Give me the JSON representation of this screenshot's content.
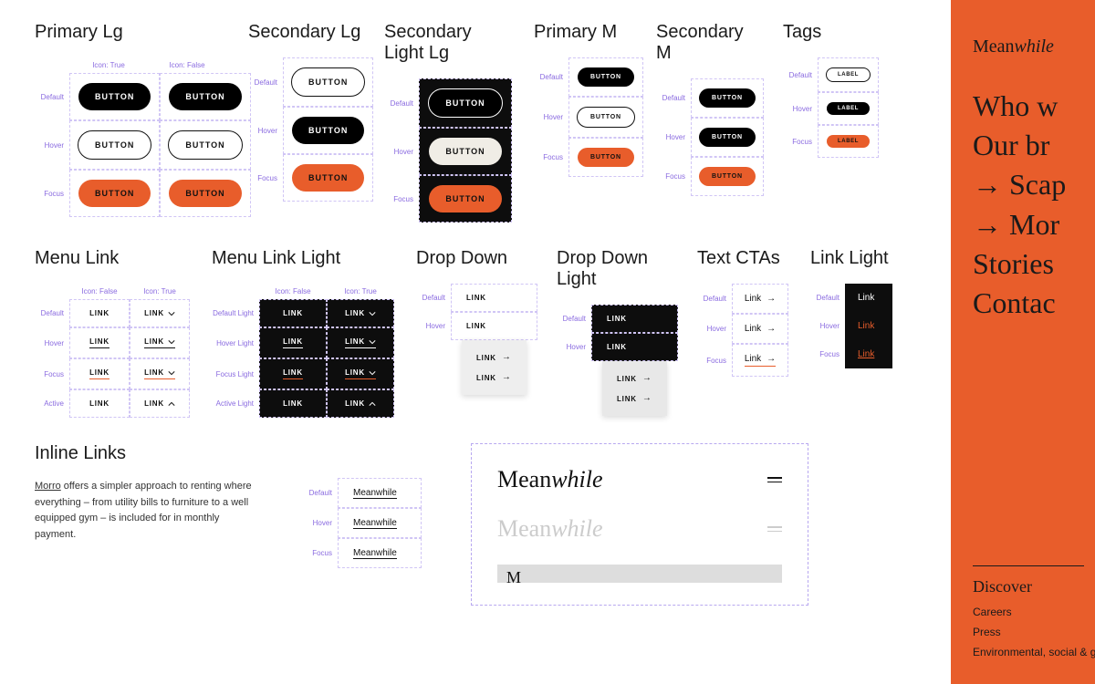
{
  "sections": {
    "primaryLg": {
      "title": "Primary Lg",
      "colLabels": [
        "Icon: True",
        "Icon: False"
      ],
      "states": [
        "Default",
        "Hover",
        "Focus"
      ],
      "label": "BUTTON"
    },
    "secondaryLg": {
      "title": "Secondary Lg",
      "states": [
        "Default",
        "Hover",
        "Focus"
      ],
      "label": "BUTTON"
    },
    "secondaryLightLg": {
      "title": "Secondary Light Lg",
      "states": [
        "Default",
        "Hover",
        "Focus"
      ],
      "label": "BUTTON"
    },
    "primaryM": {
      "title": "Primary M",
      "states": [
        "Default",
        "Hover",
        "Focus"
      ],
      "label": "BUTTON"
    },
    "secondaryM": {
      "title": "Secondary M",
      "states": [
        "Default",
        "Hover",
        "Focus"
      ],
      "label": "BUTTON"
    },
    "tags": {
      "title": "Tags",
      "states": [
        "Default",
        "Hover",
        "Focus"
      ],
      "label": "LABEL"
    },
    "menuLink": {
      "title": "Menu Link",
      "colLabels": [
        "Icon: False",
        "Icon: True"
      ],
      "states": [
        "Default",
        "Hover",
        "Focus",
        "Active"
      ],
      "label": "LINK"
    },
    "menuLinkLight": {
      "title": "Menu Link Light",
      "colLabels": [
        "Icon: False",
        "Icon: True"
      ],
      "states": [
        "Default Light",
        "Hover Light",
        "Focus Light",
        "Active Light"
      ],
      "label": "LINK"
    },
    "dropDown": {
      "title": "Drop Down",
      "states": [
        "Default",
        "Hover"
      ],
      "label": "LINK"
    },
    "dropDownLight": {
      "title": "Drop Down Light",
      "states": [
        "Default",
        "Hover"
      ],
      "label": "LINK"
    },
    "textCtas": {
      "title": "Text CTAs",
      "states": [
        "Default",
        "Hover",
        "Focus"
      ],
      "label": "Link"
    },
    "linkLight": {
      "title": "Link Light",
      "states": [
        "Default",
        "Hover",
        "Focus"
      ],
      "label": "Link"
    },
    "inlineLinks": {
      "title": "Inline Links",
      "text_lead": "Morro",
      "text_body": " offers a simpler approach to renting where everything – from utility bills to furniture to a well equipped gym – is included for in monthly payment.",
      "states": [
        "Default",
        "Hover",
        "Focus"
      ],
      "label": "Meanwhile"
    }
  },
  "preview": {
    "brand_a": "Mean",
    "brand_b": "while"
  },
  "sidebar": {
    "brand_a": "Mean",
    "brand_b": "while",
    "menu": [
      "Who w",
      "Our br",
      "→  Scap",
      "→  Mor",
      "Stories",
      "Contac"
    ],
    "footer_title": "Discover",
    "footer_links": [
      "Careers",
      "Press",
      "Environmental, social & governance"
    ]
  }
}
